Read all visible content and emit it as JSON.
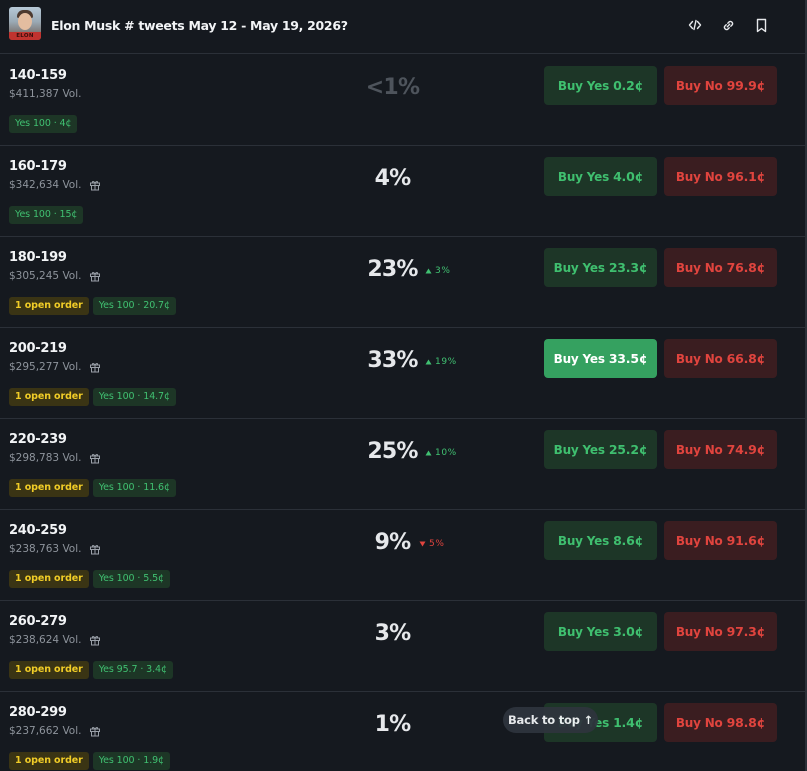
{
  "header": {
    "title": "Elon Musk # tweets May 12 - May 19, 2026?",
    "avatar_badge_text": "ELON",
    "icons": [
      "embed-icon",
      "link-icon",
      "bookmark-icon"
    ]
  },
  "colors": {
    "background": "#15191f",
    "yes_green": "#3fbf6f",
    "no_red": "#e0443e",
    "order_yellow": "#f0cc27"
  },
  "labels": {
    "buy_yes": "Buy Yes",
    "buy_no": "Buy No",
    "back_to_top": "Back to top ↑"
  },
  "rows": [
    {
      "range": "140-159",
      "volume": "$411,387 Vol.",
      "gift": false,
      "probability": "<1%",
      "muted": true,
      "change": "",
      "change_dir": "",
      "yes_price": "0.2¢",
      "no_price": "99.9¢",
      "open_order": "",
      "position": "Yes 100 · 4¢",
      "active": false
    },
    {
      "range": "160-179",
      "volume": "$342,634 Vol.",
      "gift": true,
      "probability": "4%",
      "muted": false,
      "change": "",
      "change_dir": "",
      "yes_price": "4.0¢",
      "no_price": "96.1¢",
      "open_order": "",
      "position": "Yes 100 · 15¢",
      "active": false
    },
    {
      "range": "180-199",
      "volume": "$305,245 Vol.",
      "gift": true,
      "probability": "23%",
      "muted": false,
      "change": "3%",
      "change_dir": "up",
      "yes_price": "23.3¢",
      "no_price": "76.8¢",
      "open_order": "1 open order",
      "position": "Yes 100 · 20.7¢",
      "active": false
    },
    {
      "range": "200-219",
      "volume": "$295,277 Vol.",
      "gift": true,
      "probability": "33%",
      "muted": false,
      "change": "19%",
      "change_dir": "up",
      "yes_price": "33.5¢",
      "no_price": "66.8¢",
      "open_order": "1 open order",
      "position": "Yes 100 · 14.7¢",
      "active": true
    },
    {
      "range": "220-239",
      "volume": "$298,783 Vol.",
      "gift": true,
      "probability": "25%",
      "muted": false,
      "change": "10%",
      "change_dir": "up",
      "yes_price": "25.2¢",
      "no_price": "74.9¢",
      "open_order": "1 open order",
      "position": "Yes 100 · 11.6¢",
      "active": false
    },
    {
      "range": "240-259",
      "volume": "$238,763 Vol.",
      "gift": true,
      "probability": "9%",
      "muted": false,
      "change": "5%",
      "change_dir": "down",
      "yes_price": "8.6¢",
      "no_price": "91.6¢",
      "open_order": "1 open order",
      "position": "Yes 100 · 5.5¢",
      "active": false
    },
    {
      "range": "260-279",
      "volume": "$238,624 Vol.",
      "gift": true,
      "probability": "3%",
      "muted": false,
      "change": "",
      "change_dir": "",
      "yes_price": "3.0¢",
      "no_price": "97.3¢",
      "open_order": "1 open order",
      "position": "Yes 95.7 · 3.4¢",
      "active": false
    },
    {
      "range": "280-299",
      "volume": "$237,662 Vol.",
      "gift": true,
      "probability": "1%",
      "muted": false,
      "change": "",
      "change_dir": "",
      "yes_price": "1.4¢",
      "no_price": "98.8¢",
      "open_order": "1 open order",
      "position": "Yes 100 · 1.9¢",
      "active": false
    }
  ]
}
